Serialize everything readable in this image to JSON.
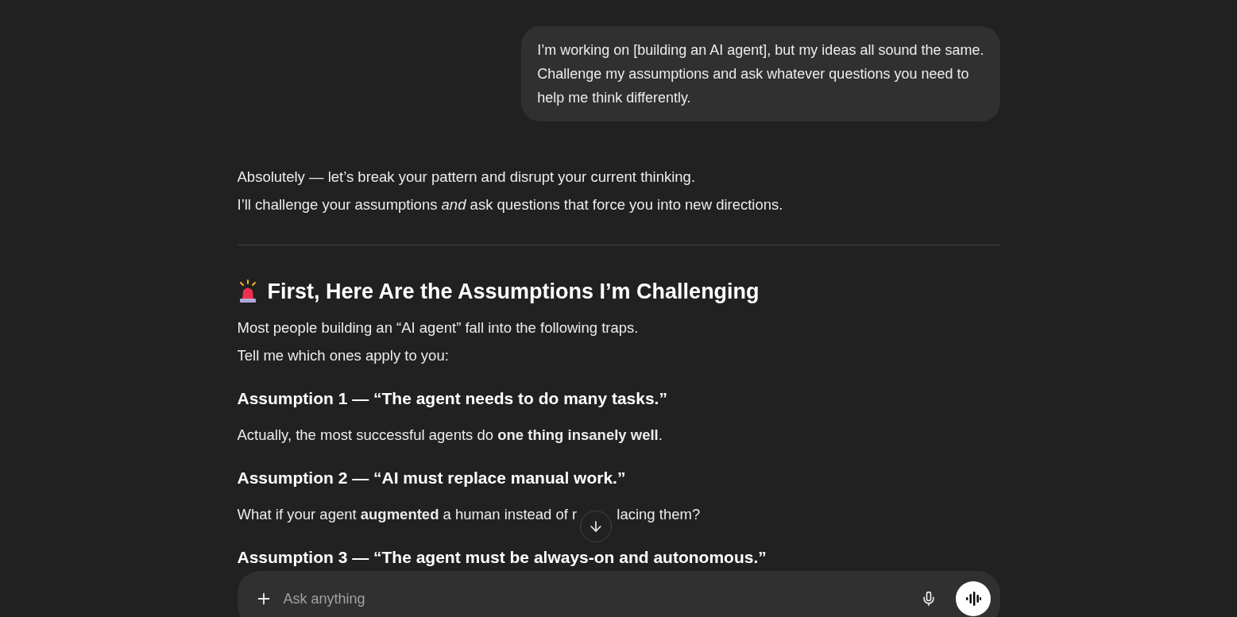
{
  "user_message": {
    "lines": [
      "I’m working on [building an AI agent], but my ideas all sound the same.",
      "Challenge my assumptions and ask whatever questions you need to",
      "help me think differently."
    ]
  },
  "assistant_blocks": [
    {
      "kind": "paragraph",
      "text": "Absolutely — let’s break your pattern and disrupt your current thinking."
    },
    {
      "kind": "paragraph",
      "text": "I’ll challenge your assumptions *and* ask questions that force you into new directions."
    },
    {
      "kind": "divider"
    },
    {
      "kind": "heading",
      "text": "First, Here Are the Assumptions I’m Challenging"
    },
    {
      "kind": "paragraph",
      "text": "Most people building an “AI agent” fall into the following traps."
    },
    {
      "kind": "paragraph",
      "text": "Tell me which ones apply to you:"
    },
    {
      "kind": "subheading",
      "text": "Assumption 1 — “The agent needs to do many tasks.”"
    },
    {
      "kind": "paragraph",
      "text": "Actually, the most successful agents do **one thing insanely well**."
    },
    {
      "kind": "subheading",
      "text": "Assumption 2 — “AI must replace manual work.”"
    },
    {
      "kind": "interrupted_paragraph",
      "parts": [
        "What if your agent **augmented** a human instead of r",
        "lacing them?"
      ]
    },
    {
      "kind": "subheading",
      "text": "Assumption 3 — “The agent must be always-on and autonomous.”"
    }
  ],
  "composer": {
    "placeholder": "Ask anything"
  }
}
